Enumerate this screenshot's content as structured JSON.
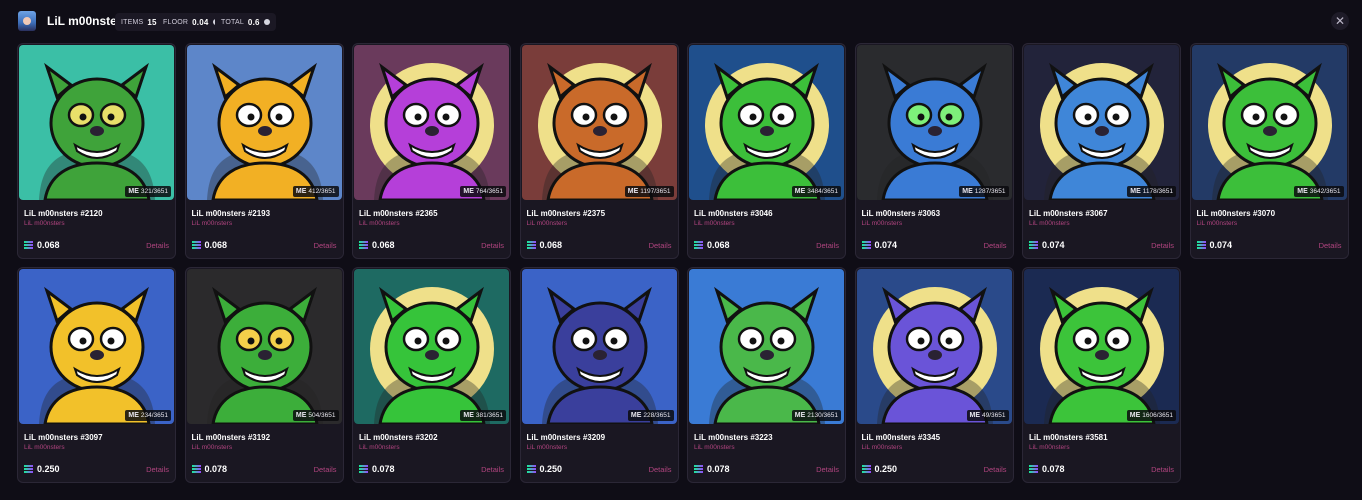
{
  "collection": {
    "title": "LiL m00nsters",
    "stats": [
      {
        "label": "ITEMS",
        "value": "15",
        "coin": false
      },
      {
        "label": "FLOOR",
        "value": "0.04",
        "coin": true
      },
      {
        "label": "TOTAL",
        "value": "0.6",
        "coin": true
      }
    ],
    "close_icon": "✕"
  },
  "card_common": {
    "collection_label": "LiL m00nsters",
    "details_label": "Details",
    "rank_mark": "ME"
  },
  "colors": {
    "background": "#0f0d16",
    "card": "#1a1722",
    "accent_pink": "#b0447f"
  },
  "items": [
    {
      "name": "LiL m00nsters #2120",
      "rank": "321/3651",
      "price": "0.068",
      "bg": "#3bbfa6",
      "moon": false,
      "body": "#3fa33a",
      "eye": "#e8e06a"
    },
    {
      "name": "LiL m00nsters #2193",
      "rank": "412/3651",
      "price": "0.068",
      "bg": "#5d86c9",
      "moon": false,
      "body": "#f2b024",
      "eye": "#ffffff"
    },
    {
      "name": "LiL m00nsters #2365",
      "rank": "764/3651",
      "price": "0.068",
      "bg": "#6a3a5c",
      "moon": true,
      "body": "#b53fd9",
      "eye": "#ffffff"
    },
    {
      "name": "LiL m00nsters #2375",
      "rank": "1197/3651",
      "price": "0.068",
      "bg": "#7a3d3a",
      "moon": true,
      "body": "#c96a2a",
      "eye": "#ffffff"
    },
    {
      "name": "LiL m00nsters #3046",
      "rank": "3484/3651",
      "price": "0.068",
      "bg": "#1f4f8c",
      "moon": true,
      "body": "#3cbf3a",
      "eye": "#ffffff"
    },
    {
      "name": "LiL m00nsters #3063",
      "rank": "1287/3651",
      "price": "0.074",
      "bg": "#2a2b2e",
      "moon": false,
      "body": "#3a7bd5",
      "eye": "#7ef07a"
    },
    {
      "name": "LiL m00nsters #3067",
      "rank": "1178/3651",
      "price": "0.074",
      "bg": "#22233a",
      "moon": true,
      "body": "#3f86d8",
      "eye": "#ffffff"
    },
    {
      "name": "LiL m00nsters #3070",
      "rank": "3642/3651",
      "price": "0.074",
      "bg": "#233a66",
      "moon": true,
      "body": "#3cbf3a",
      "eye": "#ffffff"
    },
    {
      "name": "LiL m00nsters #3097",
      "rank": "234/3651",
      "price": "0.250",
      "bg": "#3b63c7",
      "moon": false,
      "body": "#f2c12a",
      "eye": "#ffffff"
    },
    {
      "name": "LiL m00nsters #3192",
      "rank": "504/3651",
      "price": "0.078",
      "bg": "#2b2a2c",
      "moon": false,
      "body": "#3cae3a",
      "eye": "#f4d04a"
    },
    {
      "name": "LiL m00nsters #3202",
      "rank": "381/3651",
      "price": "0.078",
      "bg": "#1e6a62",
      "moon": true,
      "body": "#36c43a",
      "eye": "#ffffff"
    },
    {
      "name": "LiL m00nsters #3209",
      "rank": "228/3651",
      "price": "0.250",
      "bg": "#3b63c7",
      "moon": false,
      "body": "#3a3f9c",
      "eye": "#ffffff"
    },
    {
      "name": "LiL m00nsters #3223",
      "rank": "2130/3651",
      "price": "0.078",
      "bg": "#3a7bd5",
      "moon": false,
      "body": "#4ab84a",
      "eye": "#ffffff"
    },
    {
      "name": "LiL m00nsters #3345",
      "rank": "49/3651",
      "price": "0.250",
      "bg": "#2a4a8a",
      "moon": true,
      "body": "#6a54d8",
      "eye": "#ffffff"
    },
    {
      "name": "LiL m00nsters #3581",
      "rank": "1606/3651",
      "price": "0.078",
      "bg": "#1b2a52",
      "moon": true,
      "body": "#3cc43a",
      "eye": "#ffffff"
    }
  ]
}
